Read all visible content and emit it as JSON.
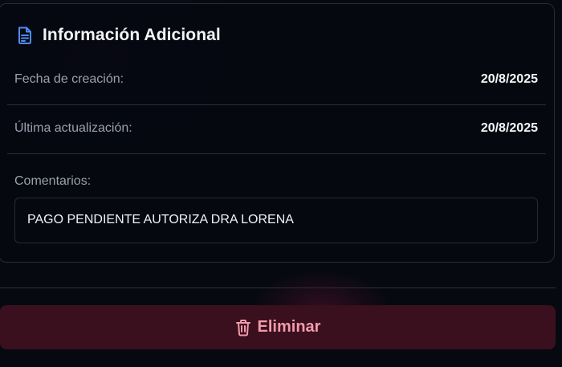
{
  "card": {
    "title": "Información Adicional",
    "icon": "document-icon",
    "accent_color": "#4f8df7"
  },
  "fields": [
    {
      "label": "Fecha de creación:",
      "value": "20/8/2025"
    },
    {
      "label": "Última actualización:",
      "value": "20/8/2025"
    }
  ],
  "comments": {
    "label": "Comentarios:",
    "text": "PAGO PENDIENTE AUTORIZA DRA LORENA"
  },
  "actions": {
    "delete_label": "Eliminar",
    "delete_icon": "trash-icon",
    "delete_color": "#f39bab"
  }
}
